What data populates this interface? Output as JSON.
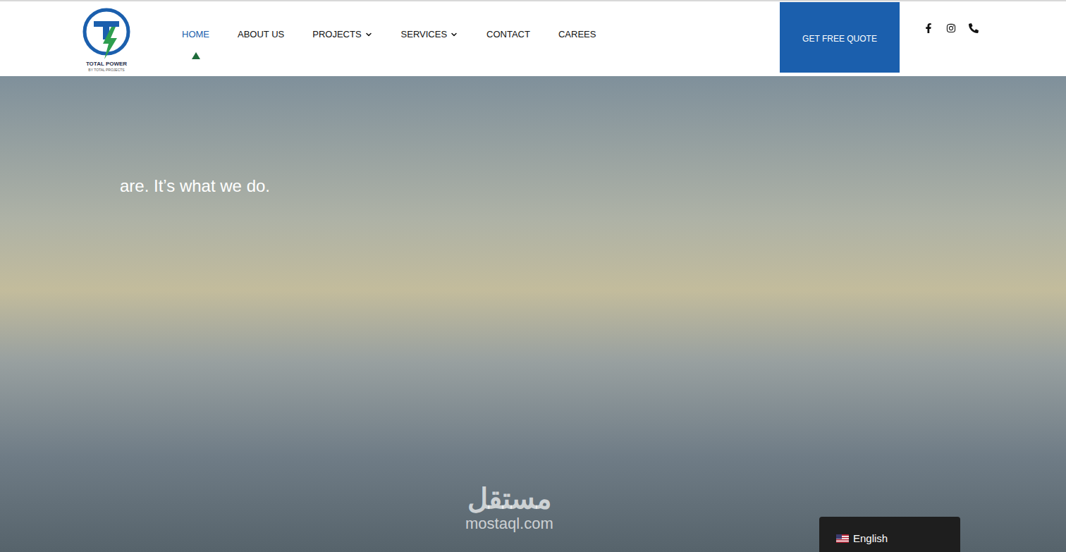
{
  "logo": {
    "name": "TOTAL POWER",
    "tagline": "BY TOTAL PROJECTS"
  },
  "nav": [
    {
      "label": "HOME",
      "selected": true,
      "dropdown": false
    },
    {
      "label": "ABOUT US",
      "selected": false,
      "dropdown": false
    },
    {
      "label": "PROJECTS",
      "selected": false,
      "dropdown": true
    },
    {
      "label": "SERVICES",
      "selected": false,
      "dropdown": true
    },
    {
      "label": "CONTACT",
      "selected": false,
      "dropdown": false
    },
    {
      "label": "CAREES",
      "selected": false,
      "dropdown": false
    }
  ],
  "quote_button": "GET FREE QUOTE",
  "hero": {
    "headline": "are. It’s what we do."
  },
  "language": {
    "label": "English"
  },
  "watermark": {
    "arabic": "مستقل",
    "latin": "mostaql.com"
  }
}
